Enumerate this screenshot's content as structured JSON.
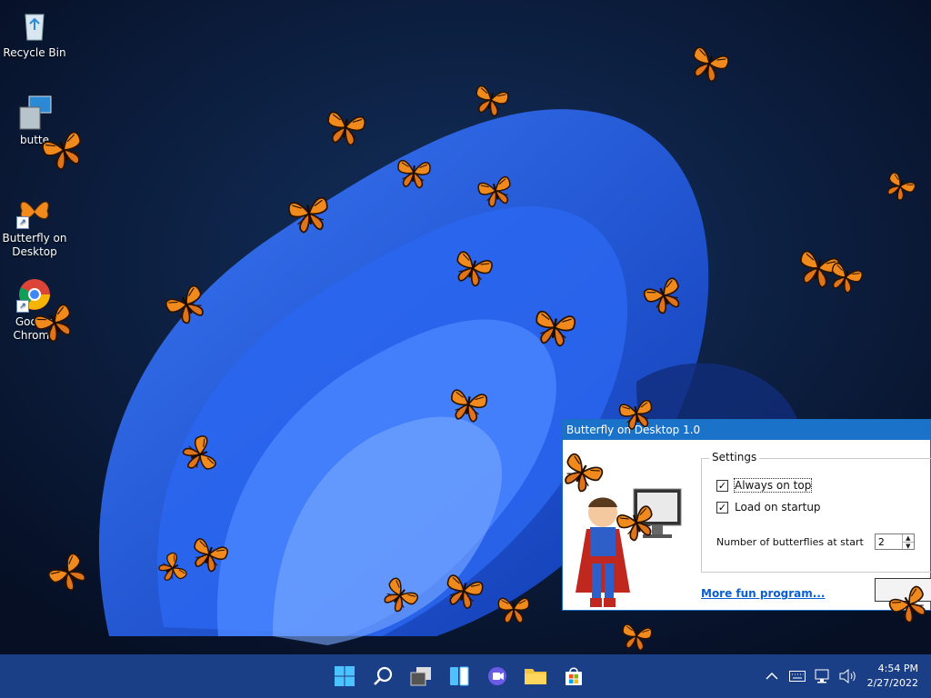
{
  "desktop": {
    "icons": [
      {
        "label": "Recycle Bin",
        "icon": "recycle-bin-icon"
      },
      {
        "label": "butte",
        "icon": "installer-icon"
      },
      {
        "label": "Butterfly on Desktop",
        "icon": "butterfly-shortcut-icon"
      },
      {
        "label": "Google Chrome",
        "icon": "chrome-icon"
      }
    ]
  },
  "dialog": {
    "title": "Butterfly on Desktop 1.0",
    "settings_label": "Settings",
    "always_on_top_label": "Always on top",
    "always_on_top_checked": true,
    "load_on_startup_label": "Load on startup",
    "load_on_startup_checked": true,
    "number_label": "Number of butterflies at start",
    "number_value": "2",
    "more_link": "More fun program..."
  },
  "taskbar": {
    "apps": [
      "start-icon",
      "search-icon",
      "task-view-icon",
      "widgets-icon",
      "chat-icon",
      "file-explorer-icon",
      "microsoft-store-icon"
    ],
    "tray": [
      "chevron-up-icon",
      "keyboard-icon",
      "network-icon",
      "volume-icon"
    ],
    "time": "4:54 PM",
    "date": "2/27/2022"
  },
  "colors": {
    "taskbar": "#1b3f86",
    "wallpaper_bg": "#0a1a3a",
    "bloom": "#1f5ce0",
    "butterfly_orange": "#f08a1c",
    "dialog_title": "#1a72c9"
  }
}
